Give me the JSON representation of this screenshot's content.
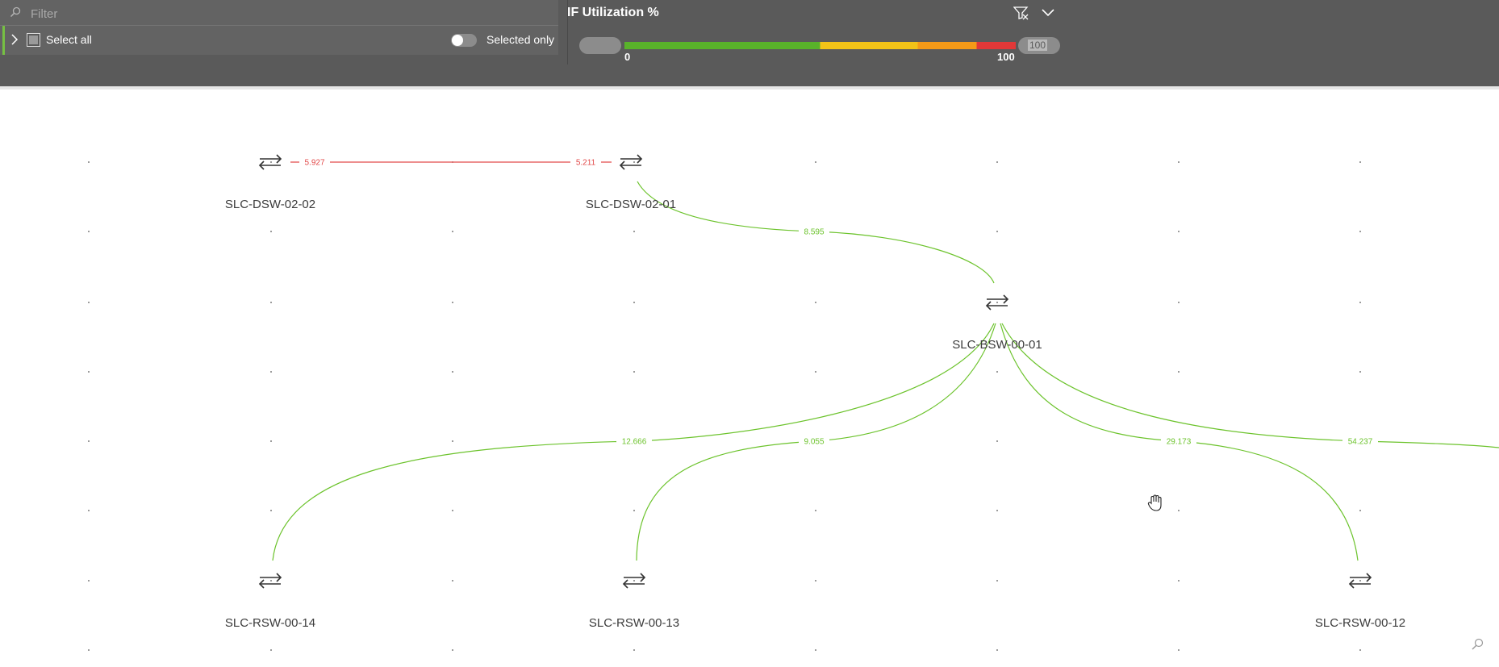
{
  "slicer": {
    "filter_placeholder": "Filter",
    "select_all_label": "Select all",
    "selected_only_label": "Selected only",
    "selected_only_on": false
  },
  "legend": {
    "title": "IF Utilization %",
    "min_label": "0",
    "max_label": "100",
    "max_input_value": "100",
    "color_stops": [
      {
        "from": 0,
        "to": 50,
        "color": "#59b22a"
      },
      {
        "from": 50,
        "to": 75,
        "color": "#f2c318"
      },
      {
        "from": 75,
        "to": 90,
        "color": "#f49a18"
      },
      {
        "from": 90,
        "to": 100,
        "color": "#e13838"
      }
    ]
  },
  "colors": {
    "link_ok": "#6cc32c",
    "link_alert": "#e24a4a",
    "node_icon": "#333333",
    "node_label": "#3c3c3c"
  },
  "nodes": [
    {
      "id": "SLC-DSW-02-02",
      "label": "SLC-DSW-02-02",
      "icon": "switch-icon"
    },
    {
      "id": "SLC-DSW-02-01",
      "label": "SLC-DSW-02-01",
      "icon": "switch-icon"
    },
    {
      "id": "SLC-BSW-00-01",
      "label": "SLC-BSW-00-01",
      "icon": "switch-icon"
    },
    {
      "id": "SLC-RSW-00-14",
      "label": "SLC-RSW-00-14",
      "icon": "switch-icon"
    },
    {
      "id": "SLC-RSW-00-13",
      "label": "SLC-RSW-00-13",
      "icon": "switch-icon"
    },
    {
      "id": "SLC-RSW-00-12",
      "label": "SLC-RSW-00-12",
      "icon": "switch-icon"
    }
  ],
  "links": [
    {
      "from": "SLC-DSW-02-02",
      "to": "SLC-DSW-02-01",
      "label_a": "5.927",
      "label_b": "5.211",
      "status": "alert"
    },
    {
      "from": "SLC-DSW-02-01",
      "to": "SLC-BSW-00-01",
      "label_a": "8.595",
      "status": "ok"
    },
    {
      "from": "SLC-BSW-00-01",
      "to": "SLC-RSW-00-14",
      "label_a": "12.666",
      "status": "ok"
    },
    {
      "from": "SLC-BSW-00-01",
      "to": "SLC-RSW-00-13",
      "label_a": "9.055",
      "status": "ok"
    },
    {
      "from": "SLC-BSW-00-01",
      "to": "SLC-RSW-00-12",
      "label_a": "29.173",
      "status": "ok"
    },
    {
      "from": "SLC-BSW-00-01",
      "to": "offscreen",
      "label_a": "54.237",
      "status": "ok"
    }
  ]
}
